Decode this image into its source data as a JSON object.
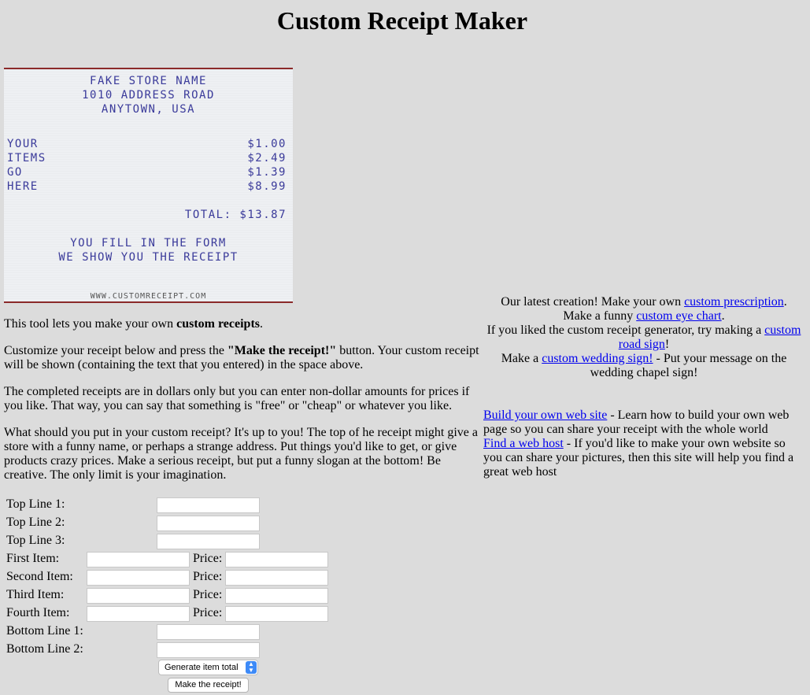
{
  "page": {
    "title": "Custom Receipt Maker"
  },
  "receipt": {
    "header": [
      "FAKE STORE NAME",
      "1010 ADDRESS ROAD",
      "ANYTOWN, USA"
    ],
    "items": [
      {
        "name": "YOUR",
        "price": "$1.00"
      },
      {
        "name": "ITEMS",
        "price": "$2.49"
      },
      {
        "name": "GO",
        "price": "$1.39"
      },
      {
        "name": "HERE",
        "price": "$8.99"
      }
    ],
    "total": "TOTAL: $13.87",
    "slogan": [
      "YOU FILL IN THE FORM",
      "WE SHOW YOU THE RECEIPT"
    ],
    "footer": "WWW.CUSTOMRECEIPT.COM"
  },
  "intro": {
    "p1_pre": "This tool lets you make your own ",
    "p1_bold": "custom receipts",
    "p1_post": ".",
    "p2_pre": "Customize your receipt below and press the ",
    "p2_bold": "\"Make the receipt!\"",
    "p2_post": " button. Your custom receipt will be shown (containing the text that you entered) in the space above.",
    "p3": "The completed receipts are in dollars only but you can enter non-dollar amounts for prices if you like. That way, you can say that something is \"free\" or \"cheap\" or whatever you like.",
    "p4": "What should you put in your custom receipt? It's up to you! The top of he receipt might give a store with a funny name, or perhaps a strange address. Put things you'd like to get, or give products crazy prices. Make a serious receipt, but put a funny slogan at the bottom! Be creative. The only limit is your imagination."
  },
  "form": {
    "top1": "Top Line 1:",
    "top2": "Top Line 2:",
    "top3": "Top Line 3:",
    "item1": "First Item:",
    "item2": "Second Item:",
    "item3": "Third Item:",
    "item4": "Fourth Item:",
    "price": "Price:",
    "bottom1": "Bottom Line 1:",
    "bottom2": "Bottom Line 2:",
    "select_value": "Generate item total",
    "submit": "Make the receipt!"
  },
  "sidebar": {
    "latest_pre": "Our latest creation! Make your own ",
    "latest_link": "custom prescription",
    "latest_post": ".",
    "eye_pre": "Make a funny ",
    "eye_link": "custom eye chart",
    "eye_post": ".",
    "road_pre": "If you liked the custom receipt generator, try making a ",
    "road_link": "custom road sign",
    "road_post": "!",
    "wedding_pre": "Make a ",
    "wedding_link": "custom wedding sign!",
    "wedding_post": " - Put your message on the wedding chapel sign!",
    "build_link": "Build your own web site",
    "build_text": " - Learn how to build your own web page so you can share your receipt with the whole world",
    "host_link": "Find a web host",
    "host_text": " - If you'd like to make your own website so you can share your pictures, then this site will help you find a great web host"
  }
}
